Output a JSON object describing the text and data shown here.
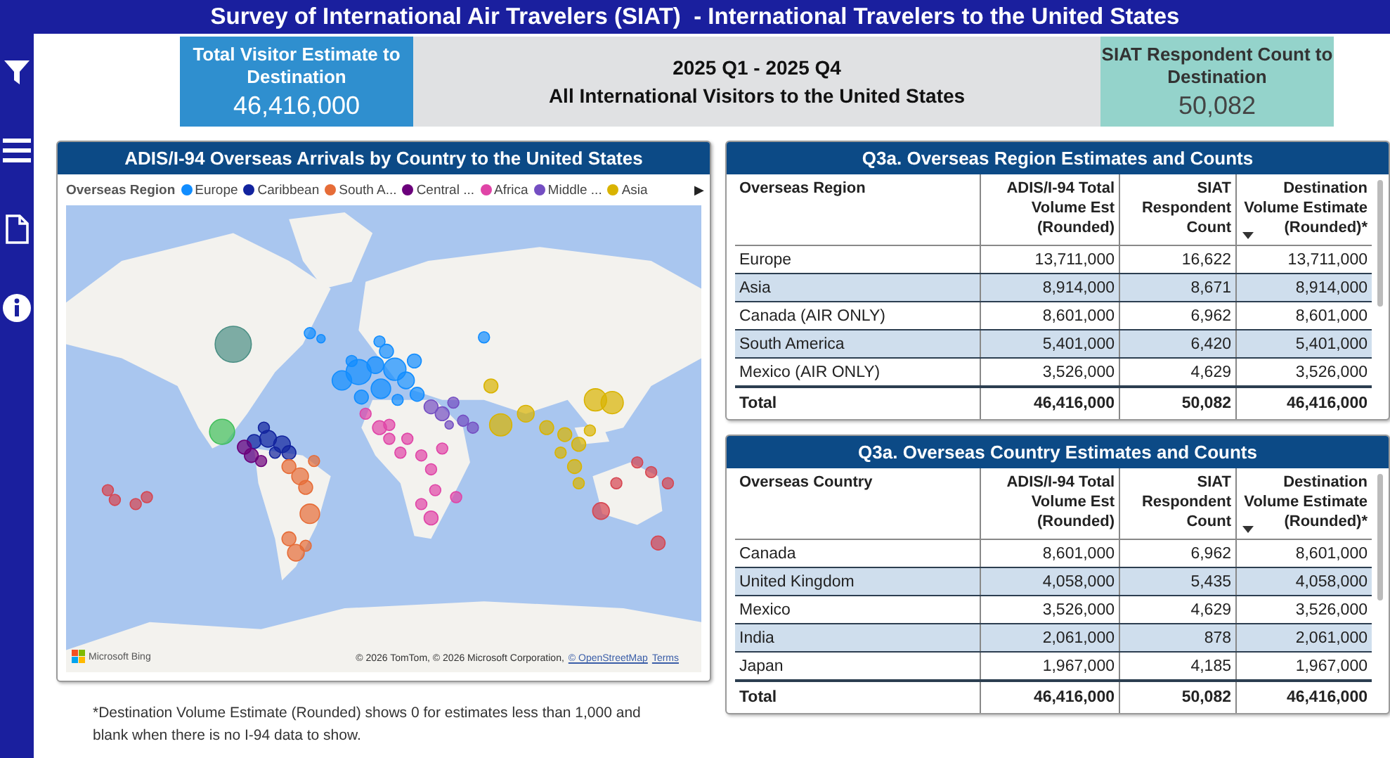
{
  "header": {
    "title": "Survey of International Air Travelers (SIAT)  - International Travelers to the United States"
  },
  "sidebar": {
    "items": [
      {
        "kind": "filter"
      },
      {
        "kind": "menu"
      },
      {
        "kind": "page"
      },
      {
        "kind": "info"
      }
    ]
  },
  "kpis": [
    {
      "label": "Total Visitor Estimate to Destination",
      "value": "46,416,000",
      "color": "#2f8fcf"
    },
    {
      "label": "SIAT Respondent Count to Destination",
      "value": "50,082",
      "color": "#94d3cb"
    }
  ],
  "period_banner": {
    "period": "2025 Q1 - 2025 Q4",
    "subtitle": "All International Visitors to the United States"
  },
  "map": {
    "title": "ADIS/I-94 Overseas Arrivals by Country to the United States",
    "legend": {
      "label": "Overseas Region",
      "items": [
        {
          "name": "Europe",
          "color": "#118dff"
        },
        {
          "name": "Caribbean",
          "color": "#12239e"
        },
        {
          "name": "South A...",
          "color": "#e66c37"
        },
        {
          "name": "Central ...",
          "color": "#6b007b"
        },
        {
          "name": "Africa",
          "color": "#e044a7"
        },
        {
          "name": "Middle ...",
          "color": "#744ec2"
        },
        {
          "name": "Asia",
          "color": "#d9b300"
        }
      ],
      "more": "▶"
    },
    "bing_label": "Microsoft Bing",
    "attribution": "© 2026 TomTom, © 2026 Microsoft Corporation, ",
    "attribution_links": [
      "© OpenStreetMap",
      "Terms"
    ]
  },
  "footnote": "*Destination Volume Estimate (Rounded) shows 0 for estimates less than 1,000 and blank when there is no I-94 data to show.",
  "tables": [
    {
      "title": "Q3a. Overseas Region Estimates and Counts",
      "columns": [
        {
          "label": "Overseas Region",
          "sorted": false
        },
        {
          "label": "ADIS/I-94 Total Volume Est (Rounded)",
          "sorted": false
        },
        {
          "label": "SIAT Respondent Count",
          "sorted": false
        },
        {
          "label": "Destination Volume Estimate (Rounded)*",
          "sorted": true
        }
      ],
      "rows": [
        [
          "Europe",
          "13,711,000",
          "16,622",
          "13,711,000"
        ],
        [
          "Asia",
          "8,914,000",
          "8,671",
          "8,914,000"
        ],
        [
          "Canada (AIR ONLY)",
          "8,601,000",
          "6,962",
          "8,601,000"
        ],
        [
          "South America",
          "5,401,000",
          "6,420",
          "5,401,000"
        ],
        [
          "Mexico (AIR ONLY)",
          "3,526,000",
          "4,629",
          "3,526,000"
        ]
      ],
      "total": [
        "Total",
        "46,416,000",
        "50,082",
        "46,416,000"
      ]
    },
    {
      "title": "Q3a. Overseas Country Estimates and Counts",
      "columns": [
        {
          "label": "Overseas Country",
          "sorted": false
        },
        {
          "label": "ADIS/I-94 Total Volume Est (Rounded)",
          "sorted": false
        },
        {
          "label": "SIAT Respondent Count",
          "sorted": false
        },
        {
          "label": "Destination Volume Estimate (Rounded)*",
          "sorted": true
        }
      ],
      "rows": [
        [
          "Canada",
          "8,601,000",
          "6,962",
          "8,601,000"
        ],
        [
          "United Kingdom",
          "4,058,000",
          "5,435",
          "4,058,000"
        ],
        [
          "Mexico",
          "3,526,000",
          "4,629",
          "3,526,000"
        ],
        [
          "India",
          "2,061,000",
          "878",
          "2,061,000"
        ],
        [
          "Japan",
          "1,967,000",
          "4,185",
          "1,967,000"
        ]
      ],
      "total": [
        "Total",
        "46,416,000",
        "50,082",
        "46,416,000"
      ]
    }
  ]
}
